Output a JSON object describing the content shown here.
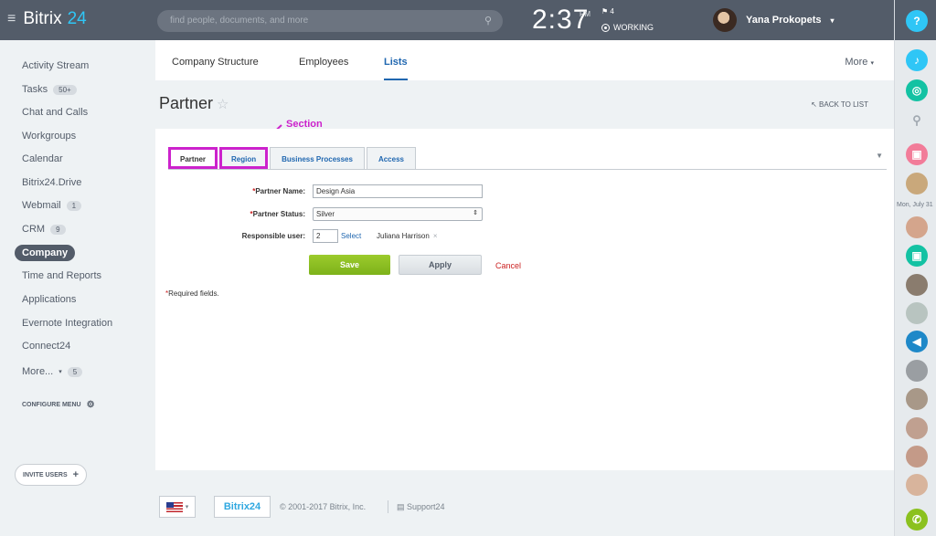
{
  "header": {
    "logo_text": "Bitrix",
    "logo_num": "24",
    "search_placeholder": "find people, documents, and more",
    "time": "2:37",
    "ampm": "PM",
    "flag_count": "4",
    "status": "WORKING",
    "user_name": "Yana Prokopets"
  },
  "sidebar": {
    "items": [
      {
        "label": "Activity Stream",
        "badge": ""
      },
      {
        "label": "Tasks",
        "badge": "50+"
      },
      {
        "label": "Chat and Calls",
        "badge": ""
      },
      {
        "label": "Workgroups",
        "badge": ""
      },
      {
        "label": "Calendar",
        "badge": ""
      },
      {
        "label": "Bitrix24.Drive",
        "badge": ""
      },
      {
        "label": "Webmail",
        "badge": "1"
      },
      {
        "label": "CRM",
        "badge": "9"
      },
      {
        "label": "Company",
        "badge": ""
      },
      {
        "label": "Time and Reports",
        "badge": ""
      },
      {
        "label": "Applications",
        "badge": ""
      },
      {
        "label": "Evernote Integration",
        "badge": ""
      },
      {
        "label": "Connect24",
        "badge": ""
      },
      {
        "label": "More...",
        "badge": "5"
      }
    ],
    "configure": "CONFIGURE MENU",
    "invite": "INVITE USERS"
  },
  "nav": {
    "tabs": [
      "Company Structure",
      "Employees",
      "Lists"
    ],
    "more": "More"
  },
  "page": {
    "title": "Partner",
    "back": "BACK TO LIST",
    "annotation": "Section"
  },
  "form": {
    "tabs": [
      "Partner",
      "Region",
      "Business Processes",
      "Access"
    ],
    "name_label": "Partner Name:",
    "name_value": "Design Asia",
    "status_label": "Partner Status:",
    "status_value": "Silver",
    "resp_label": "Responsible user:",
    "resp_id": "2",
    "select_link": "Select",
    "resp_name": "Juliana Harrison",
    "save": "Save",
    "apply": "Apply",
    "cancel": "Cancel",
    "required_note": "Required fields."
  },
  "rightbar": {
    "help": "?",
    "date": "Mon, July 31"
  },
  "footer": {
    "logo": "Bitrix24",
    "copyright": "© 2001-2017 Bitrix, Inc.",
    "support": "Support24"
  },
  "colors": {
    "header_bg": "#535c69",
    "accent": "#2067b0",
    "save_green": "#8bc11f",
    "annotation": "#cc22cc",
    "required": "#cc2222"
  }
}
